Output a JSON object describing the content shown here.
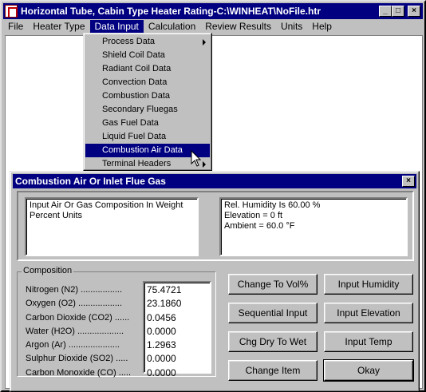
{
  "window": {
    "title": "Horizontal Tube, Cabin Type Heater Rating-C:\\WINHEAT\\NoFile.htr",
    "buttons": {
      "minimize": "_",
      "maximize": "□",
      "close": "×"
    }
  },
  "menu": [
    "File",
    "Heater Type",
    "Data Input",
    "Calculation",
    "Review Results",
    "Units",
    "Help"
  ],
  "data_input_menu": {
    "items": [
      {
        "label": "Process Data",
        "submenu": true
      },
      {
        "label": "Shield Coil Data"
      },
      {
        "label": "Radiant Coil Data"
      },
      {
        "label": "Convection Data"
      },
      {
        "label": "Combustion Data"
      },
      {
        "label": "Secondary Fluegas"
      },
      {
        "label": "Gas Fuel Data"
      },
      {
        "label": "Liquid Fuel Data"
      },
      {
        "label": "Combustion Air Data",
        "highlighted": true
      },
      {
        "label": "Terminal Headers",
        "submenu": true
      }
    ]
  },
  "dialog": {
    "title": "Combustion Air Or  Inlet Flue Gas",
    "close": "×",
    "info_left": "Input Air Or Gas Composition In Weight Percent Units",
    "info_right": [
      "Rel. Humidity Is 60.00 %",
      "Elevation = 0 ft",
      "Ambient = 60.0 °F"
    ],
    "composition_label": "Composition",
    "components": [
      {
        "label": "Nitrogen (N2) .................",
        "value": "75.4721"
      },
      {
        "label": "Oxygen (O2) ..................",
        "value": "23.1860"
      },
      {
        "label": "Carbon Dioxide (CO2) ......",
        "value": "0.0456"
      },
      {
        "label": "Water (H2O) ...................",
        "value": "0.0000"
      },
      {
        "label": "Argon (Ar) .....................",
        "value": "1.2963"
      },
      {
        "label": "Sulphur Dioxide (SO2) .....",
        "value": "0.0000"
      },
      {
        "label": "Carbon Monoxide (CO) .....",
        "value": "0.0000"
      }
    ],
    "buttons": {
      "change_to_vol": "Change To Vol%",
      "input_humidity": "Input Humidity",
      "sequential_input": "Sequential Input",
      "input_elevation": "Input Elevation",
      "chg_dry_to_wet": "Chg Dry To Wet",
      "input_temp": "Input Temp",
      "change_item": "Change Item",
      "okay": "Okay"
    }
  }
}
